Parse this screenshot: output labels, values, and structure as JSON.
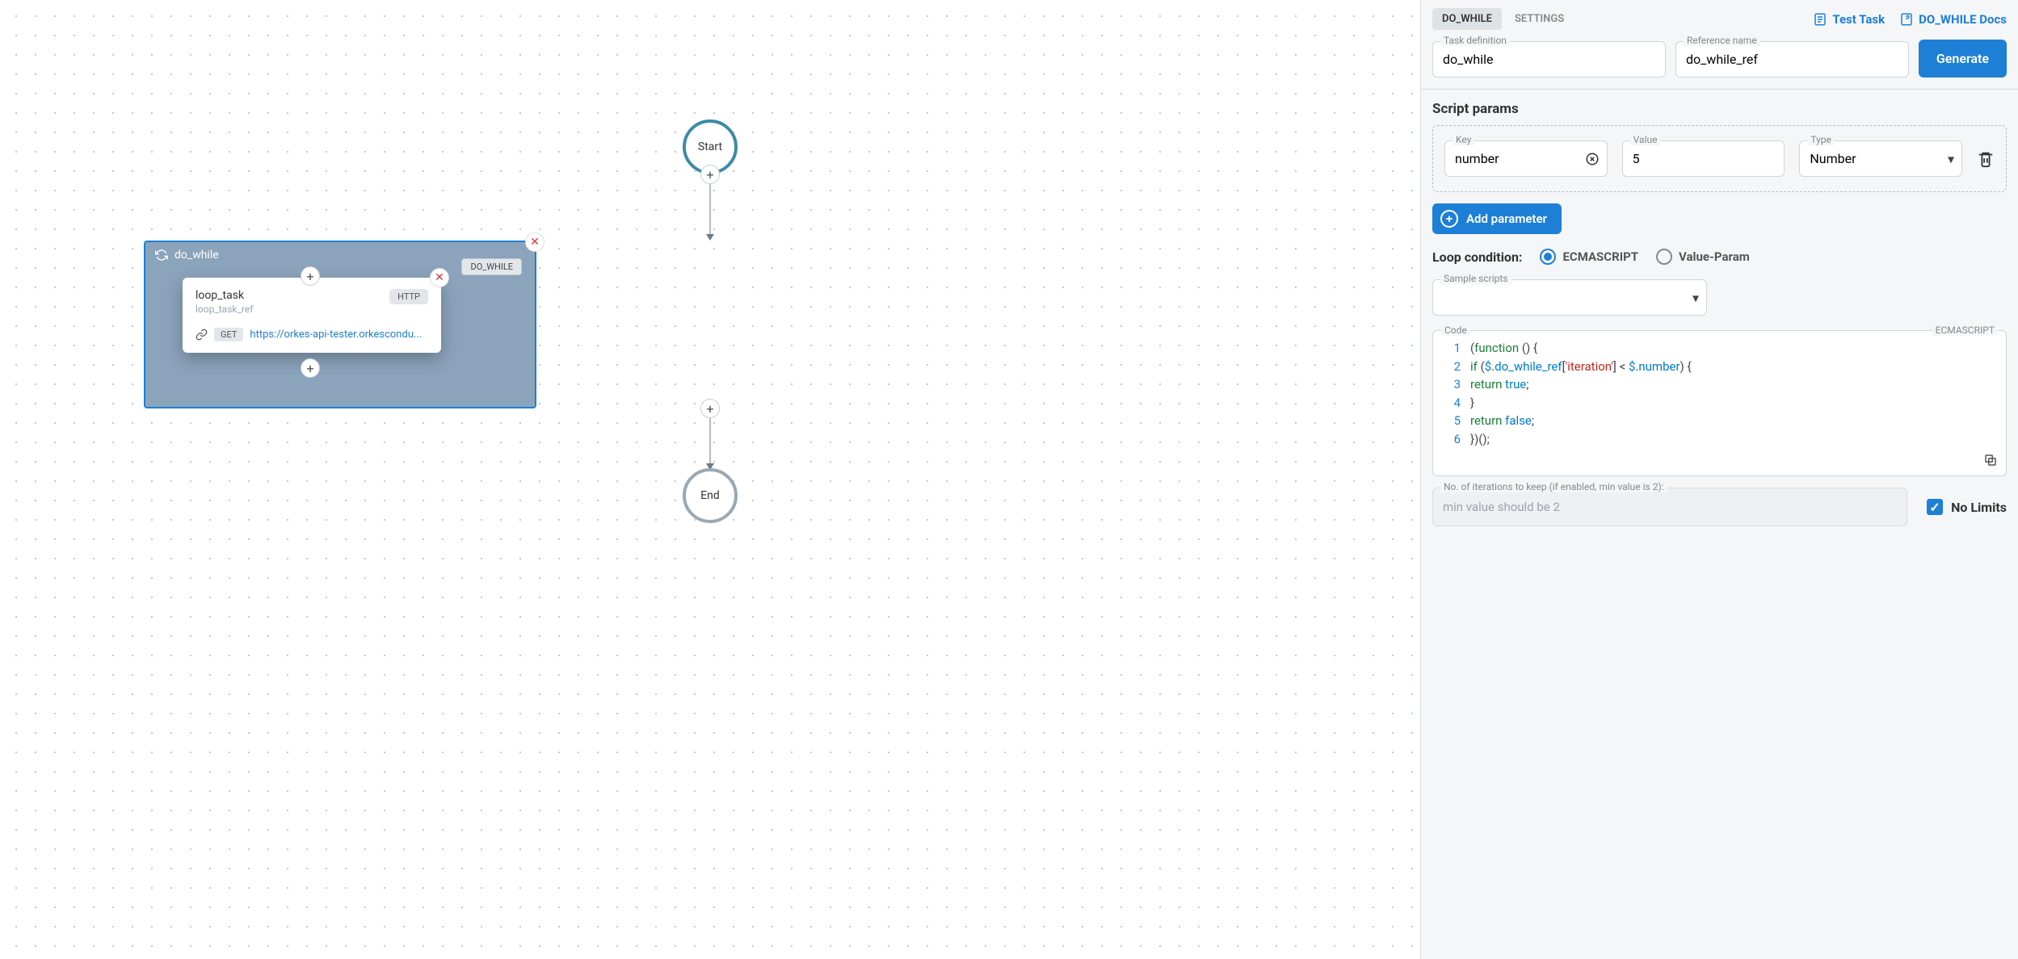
{
  "canvas": {
    "start_label": "Start",
    "end_label": "End",
    "do_while": {
      "title": "do_while",
      "badge": "DO_WHILE",
      "inner_task": {
        "name": "loop_task",
        "ref": "loop_task_ref",
        "type_badge": "HTTP",
        "method": "GET",
        "url": "https://orkes-api-tester.orkescondu..."
      }
    }
  },
  "panel": {
    "tabs": [
      "DO_WHILE",
      "SETTINGS"
    ],
    "active_tab": 0,
    "links": {
      "test_task": "Test Task",
      "docs": "DO_WHILE Docs"
    },
    "task_def_label": "Task definition",
    "task_def_value": "do_while",
    "ref_label": "Reference name",
    "ref_value": "do_while_ref",
    "generate_label": "Generate",
    "script_params_title": "Script params",
    "param_key_label": "Key",
    "param_key_value": "number",
    "param_value_label": "Value",
    "param_value_value": "5",
    "param_type_label": "Type",
    "param_type_value": "Number",
    "add_param_label": "Add parameter",
    "loop_cond_label": "Loop condition:",
    "loop_opts": [
      "ECMASCRIPT",
      "Value-Param"
    ],
    "loop_selected": 0,
    "sample_label": "Sample scripts",
    "code_label": "Code",
    "code_lang": "ECMASCRIPT",
    "code_lines": [
      {
        "ln": "1",
        "tokens": [
          [
            "pun",
            "("
          ],
          [
            "kw",
            "function "
          ],
          [
            "pun",
            "() {"
          ]
        ]
      },
      {
        "ln": "2",
        "tokens": [
          [
            "pun",
            "  "
          ],
          [
            "kw",
            "if "
          ],
          [
            "pun",
            "("
          ],
          [
            "var",
            "$"
          ],
          [
            "pun",
            "."
          ],
          [
            "var",
            "do_while_ref"
          ],
          [
            "pun",
            "["
          ],
          [
            "str",
            "'iteration'"
          ],
          [
            "pun",
            "] < "
          ],
          [
            "var",
            "$"
          ],
          [
            "pun",
            "."
          ],
          [
            "var",
            "number"
          ],
          [
            "pun",
            ") {"
          ]
        ]
      },
      {
        "ln": "3",
        "tokens": [
          [
            "pun",
            "    "
          ],
          [
            "kw",
            "return "
          ],
          [
            "bool",
            "true"
          ],
          [
            "pun",
            ";"
          ]
        ]
      },
      {
        "ln": "4",
        "tokens": [
          [
            "pun",
            "  }"
          ]
        ]
      },
      {
        "ln": "5",
        "tokens": [
          [
            "pun",
            "  "
          ],
          [
            "kw",
            "return "
          ],
          [
            "bool",
            "false"
          ],
          [
            "pun",
            ";"
          ]
        ]
      },
      {
        "ln": "6",
        "tokens": [
          [
            "pun",
            "})();"
          ]
        ]
      }
    ],
    "iter_label": "No. of iterations to keep (if enabled, min value is 2):",
    "iter_placeholder": "min value should be 2",
    "nolimits_label": "No Limits",
    "nolimits_checked": true
  }
}
